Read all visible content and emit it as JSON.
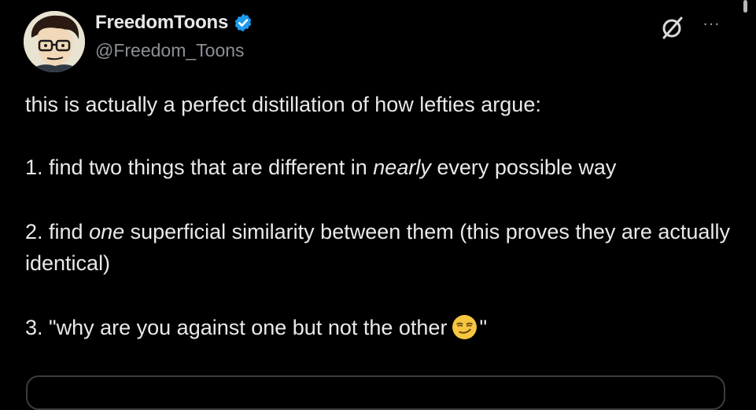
{
  "author": {
    "display_name": "FreedomToons",
    "handle": "@Freedom_Toons",
    "verified": true,
    "avatar_icon": "cartoon-face-avatar"
  },
  "header_actions": {
    "grok_icon": "grok-slash-icon",
    "more_icon": "more-dots-icon",
    "more_label": "···"
  },
  "post": {
    "line1": "this is actually a perfect distillation of how lefties argue:",
    "item1_pre": "1. find two things that are different in ",
    "item1_em": "nearly",
    "item1_post": " every possible way",
    "item2_pre": "2. find ",
    "item2_em": "one",
    "item2_post": " superficial similarity between them (this proves they are actually identical)",
    "item3_pre": "3. \"why are you against one but not the other",
    "item3_emoji": "smirking-face-emoji",
    "item3_post": "\""
  },
  "colors": {
    "background": "#000000",
    "text_primary": "#e7e9ea",
    "text_secondary": "#8b9197",
    "verified_blue": "#1d9bf0",
    "emoji_yellow": "#f7c640"
  }
}
